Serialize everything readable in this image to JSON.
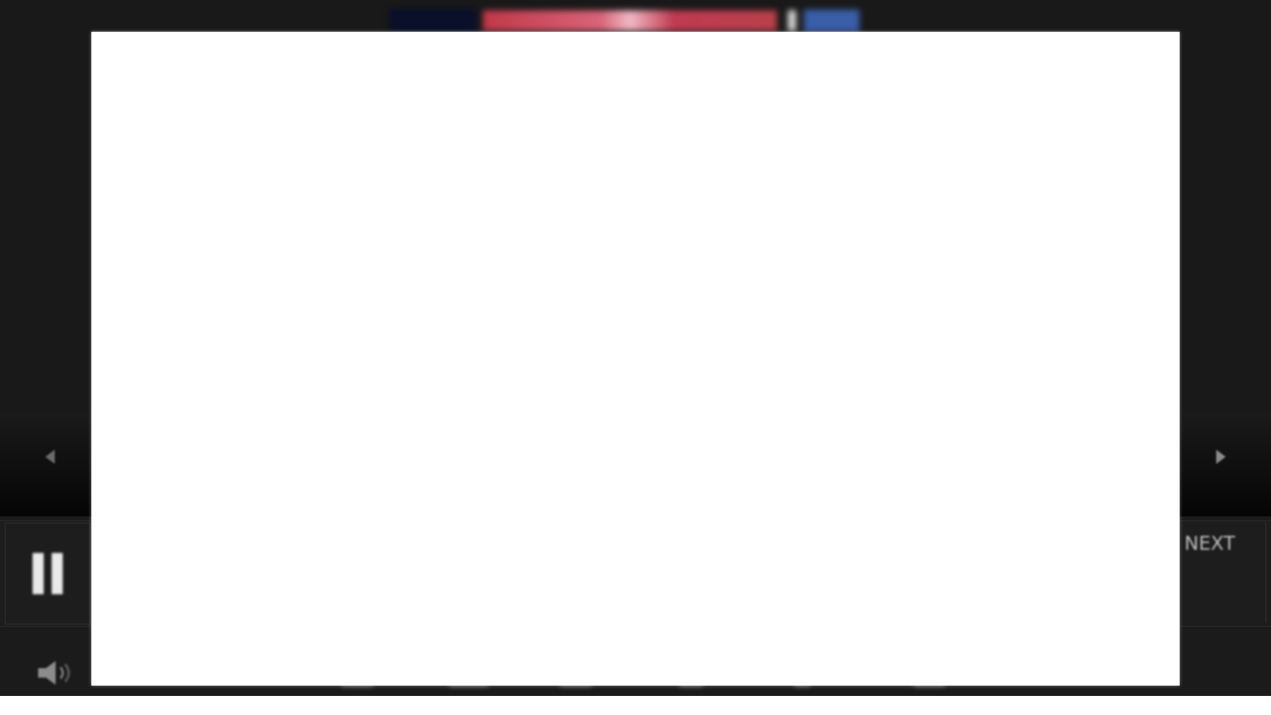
{
  "player": {
    "controls": {
      "pause_icon": "pause-icon",
      "prev_icon": "chevron-left-icon",
      "next_icon": "chevron-right-icon",
      "volume_icon": "volume-icon",
      "right_panel_label": "NEXT"
    },
    "colors": {
      "player_background": "#1b1b1b",
      "overlay_background": "#ffffff",
      "banner_red": "#c03848",
      "banner_blue": "#3a5ea8"
    }
  }
}
